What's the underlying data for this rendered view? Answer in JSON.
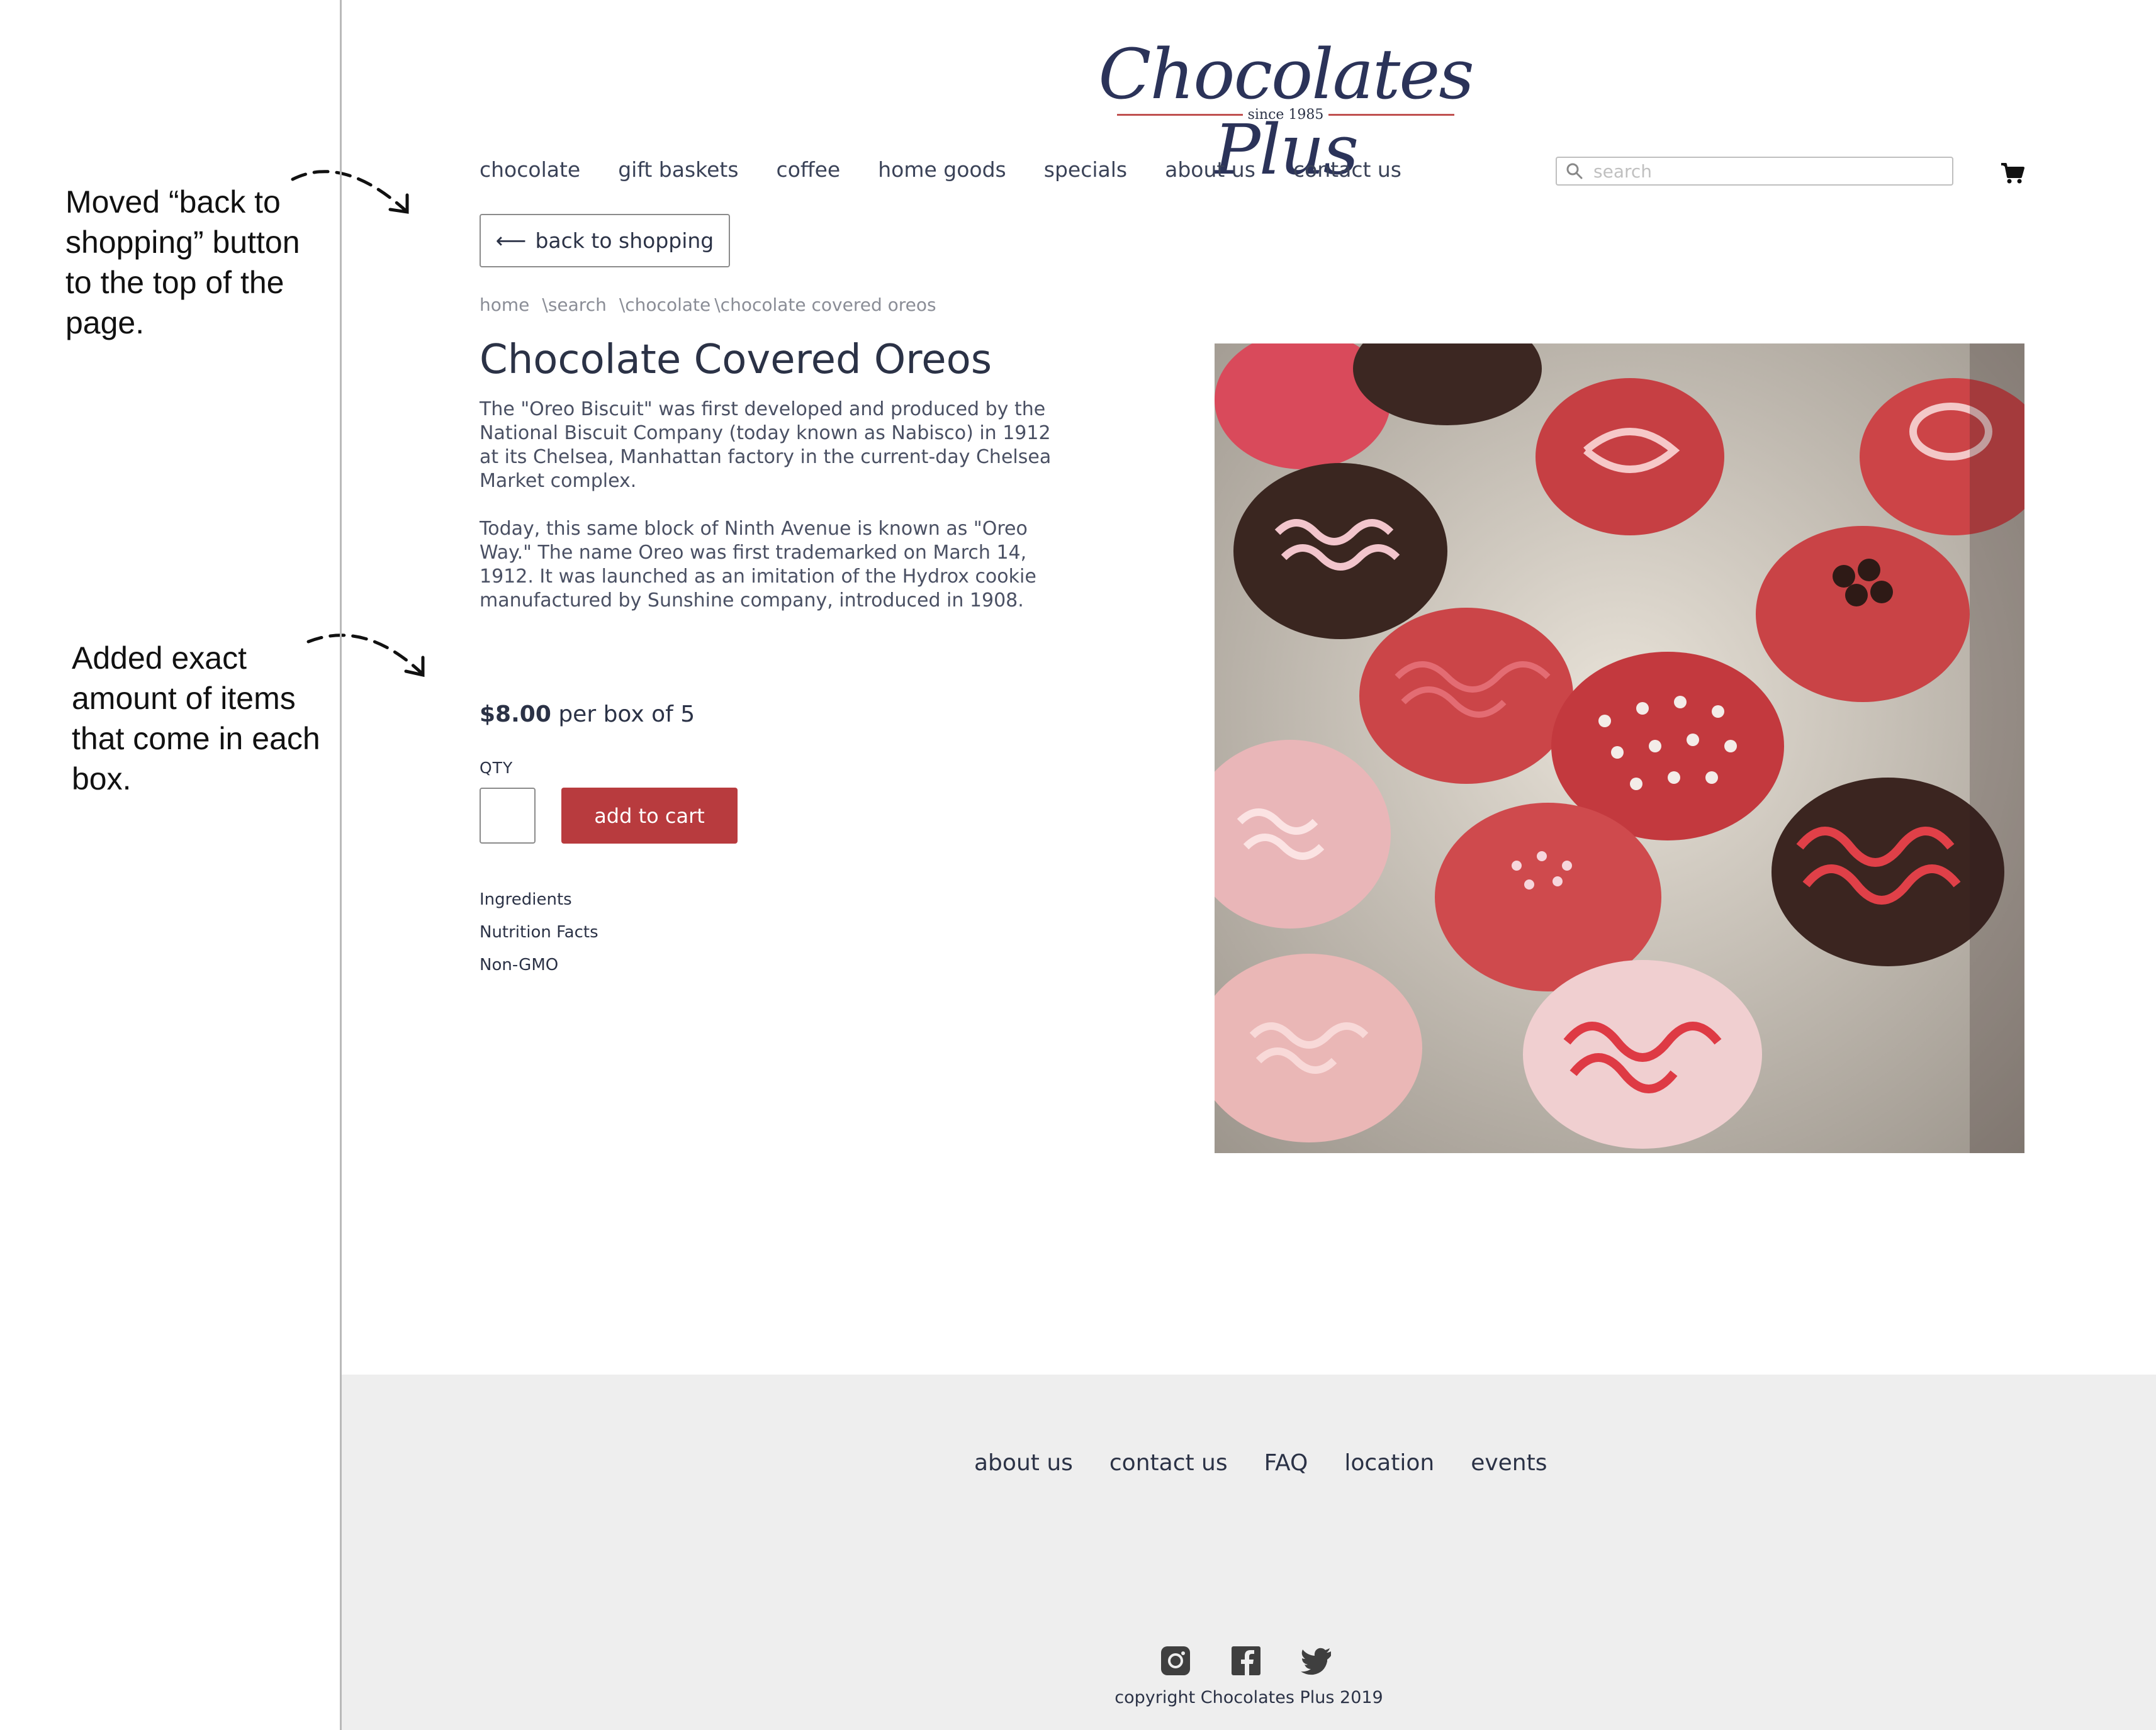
{
  "annotations": {
    "note1": "Moved “back to shopping” button to the top of the page.",
    "note2": "Added exact amount of items that come in each box."
  },
  "logo": {
    "name": "Chocolates Plus",
    "since": "since 1985"
  },
  "nav": {
    "items": [
      "chocolate",
      "gift baskets",
      "coffee",
      "home goods",
      "specials",
      "about us",
      "contact us"
    ]
  },
  "search": {
    "placeholder": "search"
  },
  "back_button": {
    "label": "back to shopping"
  },
  "breadcrumb": [
    "home",
    "search",
    "chocolate",
    "chocolate covered oreos"
  ],
  "product": {
    "title": "Chocolate Covered Oreos",
    "description": [
      "The \"Oreo Biscuit\" was first developed and produced by the National Biscuit Company (today known as Nabisco) in 1912 at its Chelsea, Manhattan factory in the current-day Chelsea Market complex.",
      "Today, this same block of Ninth Avenue is known as \"Oreo Way.\" The name Oreo was first trademarked on March 14, 1912. It was launched as an imitation of the Hydrox cookie manufactured by Sunshine company, introduced in 1908."
    ],
    "price": "$8.00",
    "price_unit": "per box of 5",
    "qty_label": "QTY",
    "add_to_cart": "add to cart",
    "info_links": [
      "Ingredients",
      "Nutrition Facts",
      "Non-GMO"
    ]
  },
  "footer": {
    "links": [
      "about us",
      "contact us",
      "FAQ",
      "location",
      "events"
    ],
    "social": [
      "instagram-icon",
      "facebook-icon",
      "twitter-icon"
    ],
    "copyright": "copyright Chocolates Plus 2019"
  },
  "colors": {
    "accent_red": "#b83b3e",
    "navy": "#2b3246",
    "footer_bg": "#eeeeee"
  }
}
